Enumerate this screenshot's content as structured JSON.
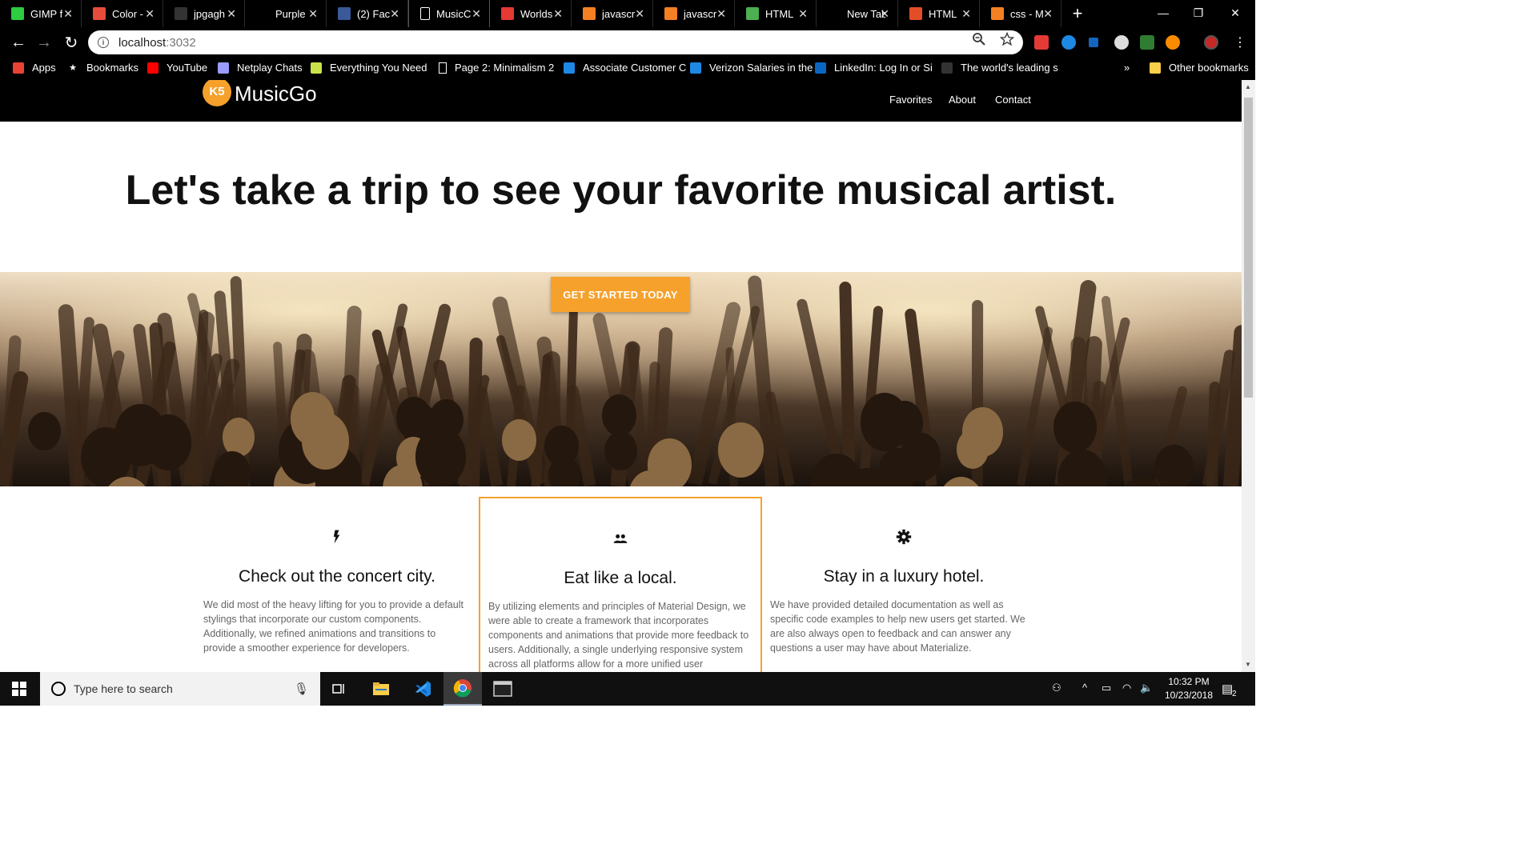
{
  "browser": {
    "tabs": [
      {
        "label": "GIMP f",
        "icon": "gimp-icon",
        "color": "#2ecc40"
      },
      {
        "label": "Color -",
        "icon": "color-site-icon",
        "color": "#e74c3c"
      },
      {
        "label": "jpgagh",
        "icon": "github-icon",
        "color": "#333333"
      },
      {
        "label": "Purple",
        "icon": "blank-icon",
        "color": "#000000"
      },
      {
        "label": "(2) Fac",
        "icon": "facebook-icon",
        "color": "#3b5998"
      },
      {
        "label": "MusicC",
        "icon": "page-icon",
        "color": "#ffffff",
        "active": true
      },
      {
        "label": "Worlds",
        "icon": "y-news-icon",
        "color": "#e53935"
      },
      {
        "label": "javascr",
        "icon": "stackoverflow-icon",
        "color": "#f48024"
      },
      {
        "label": "javascr",
        "icon": "stackoverflow-icon",
        "color": "#f48024"
      },
      {
        "label": "HTML",
        "icon": "w3schools-icon",
        "color": "#4caf50"
      },
      {
        "label": "New Tab",
        "icon": "none",
        "color": "#000000"
      },
      {
        "label": "HTML",
        "icon": "html-icon",
        "color": "#e44d26"
      },
      {
        "label": "css - M",
        "icon": "stackoverflow-icon",
        "color": "#f48024"
      }
    ],
    "new_tab_symbol": "+",
    "window_controls": {
      "minimize": "—",
      "restore": "❐",
      "close": "✕"
    },
    "url_host": "localhost",
    "url_port": ":3032",
    "bookmarks": [
      {
        "label": "Apps",
        "icon": "apps-grid-icon"
      },
      {
        "label": "Bookmarks",
        "icon": "star-icon"
      },
      {
        "label": "YouTube",
        "icon": "youtube-icon"
      },
      {
        "label": "Netplay Chats",
        "icon": "netplay-icon"
      },
      {
        "label": "Everything You Need",
        "icon": "shield-icon"
      },
      {
        "label": "Page 2: Minimalism 2",
        "icon": "page-icon"
      },
      {
        "label": "Associate Customer C",
        "icon": "walmart-icon"
      },
      {
        "label": "Verizon Salaries in the",
        "icon": "info-icon"
      },
      {
        "label": "LinkedIn: Log In or Si",
        "icon": "linkedin-icon"
      },
      {
        "label": "The world's leading s",
        "icon": "github-icon"
      }
    ],
    "bookmarks_overflow": "»",
    "other_bookmarks": "Other bookmarks"
  },
  "site": {
    "brand": "MusicGo",
    "brand_badge": "K5",
    "nav": [
      "Favorites",
      "About",
      "Contact"
    ],
    "hero_title": "Let's take a trip to see your favorite musical artist.",
    "cta": "GET STARTED TODAY",
    "features": [
      {
        "icon": "flash-icon",
        "title": "Check out the concert city.",
        "body": "We did most of the heavy lifting for you to provide a default stylings that incorporate our custom components. Additionally, we refined animations and transitions to provide a smoother experience for developers."
      },
      {
        "icon": "group-icon",
        "title": "Eat like a local.",
        "body": "By utilizing elements and principles of Material Design, we were able to create a framework that incorporates components and animations that provide more feedback to users. Additionally, a single underlying responsive system across all platforms allow for a more unified user experience."
      },
      {
        "icon": "settings-icon",
        "title": "Stay in a luxury hotel.",
        "body": "We have provided detailed documentation as well as specific code examples to help new users get started. We are also always open to feedback and can answer any questions a user may have about Materialize."
      }
    ],
    "accent_color": "#f6a12c"
  },
  "taskbar": {
    "search_placeholder": "Type here to search",
    "time": "10:32 PM",
    "date": "10/23/2018",
    "notification_count": "2"
  }
}
